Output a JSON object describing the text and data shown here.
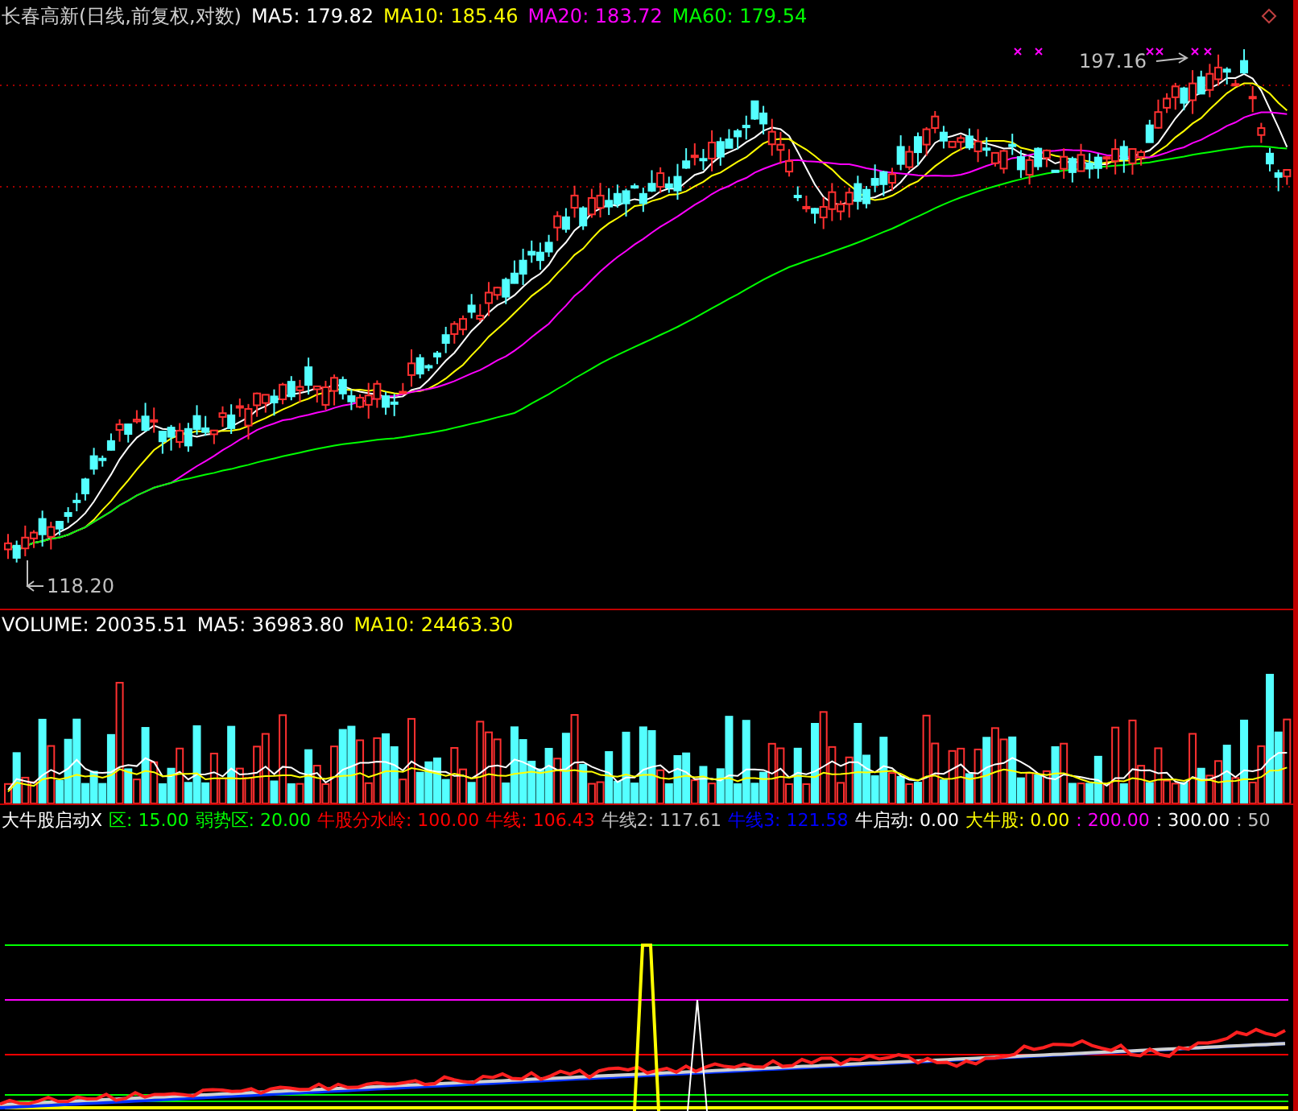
{
  "price_panel": {
    "title": "长春高新(日线,前复权,对数)",
    "indicators": [
      {
        "label": "MA5: 179.82",
        "color": "#ffffff"
      },
      {
        "label": "MA10: 185.46",
        "color": "#ffff00"
      },
      {
        "label": "MA20: 183.72",
        "color": "#ff00ff"
      },
      {
        "label": "MA60: 179.54",
        "color": "#00ff00"
      }
    ],
    "high_label": "197.16",
    "low_label": "118.20"
  },
  "volume_panel": {
    "indicators": [
      {
        "label": "VOLUME: 20035.51",
        "color": "#ffffff"
      },
      {
        "label": "MA5: 36983.80",
        "color": "#ffffff"
      },
      {
        "label": "MA10: 24463.30",
        "color": "#ffff00"
      }
    ]
  },
  "signal_panel": {
    "indicators": [
      {
        "label": "大牛股启动X",
        "color": "#ffffff"
      },
      {
        "label": "区: 15.00",
        "color": "#00ff00"
      },
      {
        "label": "弱势区: 20.00",
        "color": "#00ff00"
      },
      {
        "label": "牛股分水岭: 100.00",
        "color": "#ff0000"
      },
      {
        "label": "牛线: 106.43",
        "color": "#ff0000"
      },
      {
        "label": "牛线2: 117.61",
        "color": "#c0c0c0"
      },
      {
        "label": "牛线3: 121.58",
        "color": "#0000ff"
      },
      {
        "label": "牛启动: 0.00",
        "color": "#ffffff"
      },
      {
        "label": "大牛股: 0.00",
        "color": "#ffff00"
      },
      {
        "label": ": 200.00",
        "color": "#ff00ff"
      },
      {
        "label": ": 300.00",
        "color": "#ffffff"
      },
      {
        "label": ": 50",
        "color": "#c0c0c0"
      }
    ]
  }
}
